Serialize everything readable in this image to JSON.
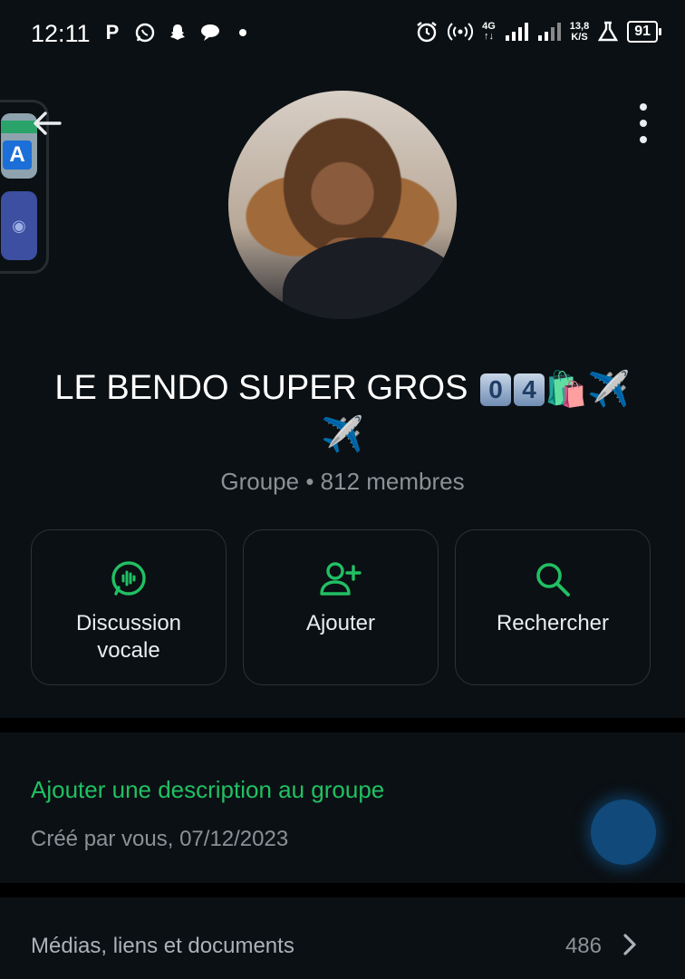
{
  "status_bar": {
    "time": "12:11",
    "left_icons": [
      "p-notification-icon",
      "whatsapp-icon",
      "snapchat-icon",
      "chat-bubble-icon",
      "dot-icon"
    ],
    "network_top": "4G",
    "network_bottom": "↑↓",
    "speed_value": "13,8",
    "speed_unit": "K/S",
    "battery": "91"
  },
  "group": {
    "name_text": "LE BENDO SUPER GROS",
    "name_keycaps": [
      "0",
      "4"
    ],
    "name_emojis": [
      "🛍️",
      "✈️",
      "✈️"
    ],
    "subtitle": "Groupe • 812 membres"
  },
  "actions": [
    {
      "label": "Discussion\nvocale",
      "icon": "voice-chat-icon"
    },
    {
      "label": "Ajouter",
      "icon": "add-person-icon"
    },
    {
      "label": "Rechercher",
      "icon": "search-icon"
    }
  ],
  "description": {
    "link": "Ajouter une description au groupe",
    "created": "Créé par vous, 07/12/2023"
  },
  "media": {
    "label": "Médias, liens et documents",
    "count": "486"
  },
  "colors": {
    "accent_green": "#21c063",
    "background": "#0b1014",
    "fab_blue": "#10497a"
  }
}
